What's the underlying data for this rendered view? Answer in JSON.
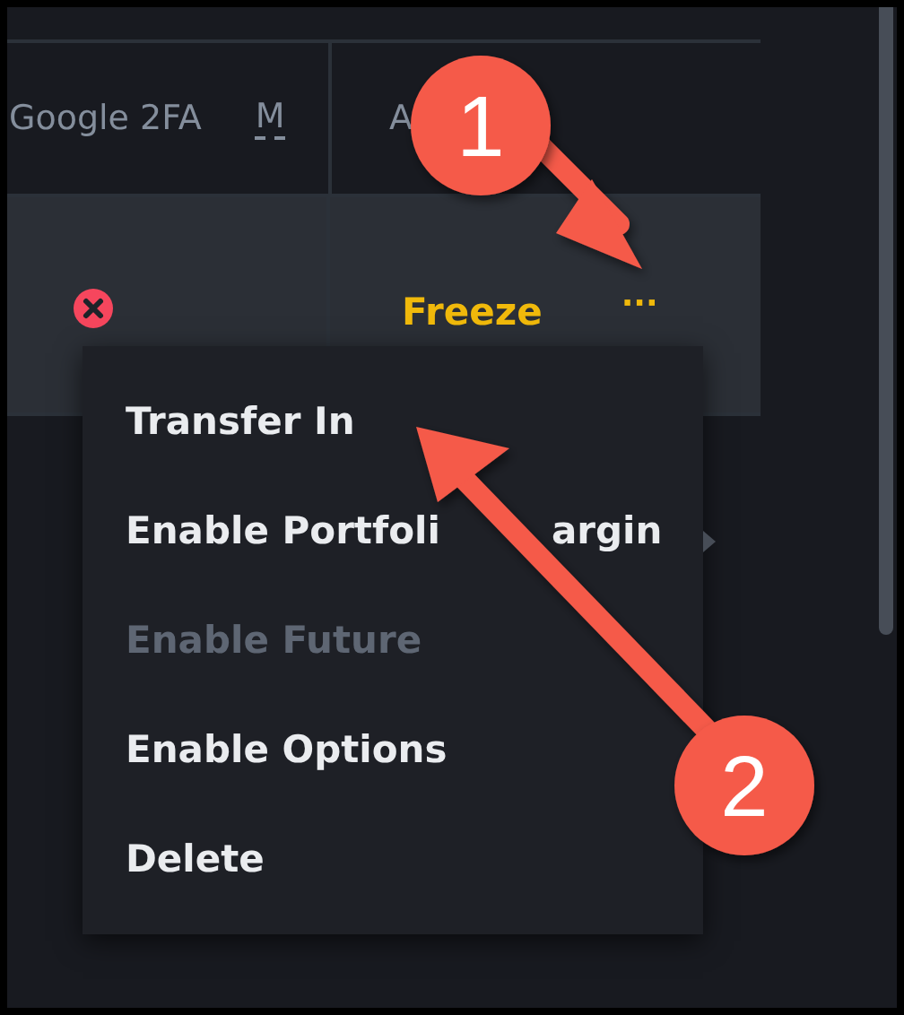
{
  "table": {
    "columns": [
      "Google 2FA",
      "M",
      "A"
    ],
    "row": {
      "failed": true,
      "action": "Freeze",
      "more": "···"
    }
  },
  "menu": {
    "items": [
      {
        "label": "Transfer In",
        "disabled": false,
        "submenu": false
      },
      {
        "label_parts": [
          "Enable Portfoli",
          "argin"
        ],
        "disabled": false,
        "submenu": true
      },
      {
        "label": "Enable Future",
        "disabled": true,
        "submenu": false
      },
      {
        "label": "Enable Options",
        "disabled": false,
        "submenu": false
      },
      {
        "label": "Delete",
        "disabled": false,
        "submenu": false
      }
    ]
  },
  "annotations": [
    {
      "label": "1",
      "kind": "arrow-down-right"
    },
    {
      "label": "2",
      "kind": "arrow-up-left"
    }
  ]
}
